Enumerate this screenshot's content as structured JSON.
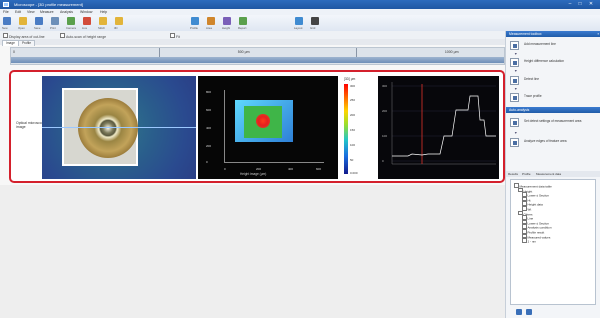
{
  "window": {
    "title": "Microscope - [3D profile measurement]"
  },
  "menu": [
    "File",
    "Edit",
    "View",
    "Measure",
    "Analysis",
    "Window",
    "Help"
  ],
  "toolbar": [
    {
      "label": "New",
      "color": "#4a7cc4"
    },
    {
      "label": "Open",
      "color": "#e2b43a"
    },
    {
      "label": "Save",
      "color": "#4a7cc4"
    },
    {
      "label": "Print",
      "color": "#6c8fb9"
    },
    {
      "label": "Camera",
      "color": "#5aa04c"
    },
    {
      "label": "Live",
      "color": "#d24b3a"
    },
    {
      "label": "Stitch",
      "color": "#e2b43a"
    },
    {
      "label": "3D",
      "color": "#e2b43a"
    },
    {
      "label": "Profile",
      "color": "#3f8bd1"
    },
    {
      "label": "Area",
      "color": "#d0862c"
    },
    {
      "label": "Height",
      "color": "#7a5fb8"
    },
    {
      "label": "Report",
      "color": "#5aa04c"
    },
    {
      "label": "Layout",
      "color": "#3f8bd1"
    },
    {
      "label": "Grid",
      "color": "#444444"
    }
  ],
  "options": [
    {
      "label": "Display area of cut-line",
      "checked": true
    },
    {
      "label": "Auto-scan of height range",
      "checked": false
    },
    {
      "label": "Fit",
      "checked": false
    }
  ],
  "tabs": [
    "Image",
    "Profile"
  ],
  "ruler": {
    "labels": [
      "0",
      "500 μm",
      "1000 μm"
    ]
  },
  "panel1": {
    "label": "Optical microscope image"
  },
  "panel2": {
    "y_ticks": [
      "800",
      "600",
      "400",
      "200",
      "0"
    ],
    "x_ticks": [
      "0",
      "200",
      "400",
      "600"
    ],
    "caption": "Height image (μm)"
  },
  "colorbar": {
    "title": "[3D] μm",
    "ticks": [
      "300",
      "250",
      "200",
      "150",
      "100",
      "50",
      "0.000"
    ]
  },
  "profile_chart": {
    "type": "line",
    "y_ticks": [
      "300",
      "200",
      "100",
      "0"
    ],
    "line_color": "#ffffff",
    "marker_color": "#e0322a"
  },
  "side": {
    "header1": "Measurement toolbox",
    "tools1": [
      {
        "label": "Add measurement line"
      },
      {
        "label": "Height difference calculation"
      },
      {
        "label": "Detect line"
      },
      {
        "label": "Trace profile"
      }
    ],
    "header2": "Auto-analysis",
    "tools2": [
      {
        "label": "Set detect settings of measurement area"
      },
      {
        "label": "Analyze edges of feature area"
      }
    ],
    "subtabs": [
      "Results",
      "Profile",
      "Measurement data"
    ],
    "tree": [
      {
        "label": "Measurement data table",
        "indent": 0
      },
      {
        "label": "Height",
        "indent": 1
      },
      {
        "label": "Lower ≤ Section",
        "indent": 2
      },
      {
        "label": "Ht",
        "indent": 2
      },
      {
        "label": "Height data",
        "indent": 2
      },
      {
        "label": "Wt",
        "indent": 2
      },
      {
        "label": "Others",
        "indent": 1
      },
      {
        "label": "Line",
        "indent": 2
      },
      {
        "label": "Lower ≤ Section",
        "indent": 2
      },
      {
        "label": "Analysis condition",
        "indent": 2
      },
      {
        "label": "Profile result",
        "indent": 2
      },
      {
        "label": "Measured values",
        "indent": 2
      },
      {
        "label": "1 - nm",
        "indent": 2
      }
    ]
  }
}
